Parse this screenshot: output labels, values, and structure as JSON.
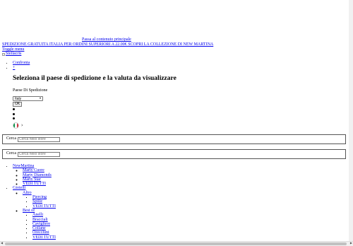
{
  "skip_link": "Passa al contenuto principale",
  "promo": "SPEDIZIONE GRATUITA ITALIA PER ORDINI SUPERIORI A 22.00€ SCOPRI LA COLLEZIONE DI NEW MARTINA",
  "toggle_menu": "Toggle menu",
  "logo_alt": "Stellacris",
  "top_links": {
    "compare": "Confronta",
    "empty": "+"
  },
  "shipping": {
    "title": "Seleziona il paese di spedizione e la valuta da visualizzare",
    "label": "Paese Di Spedizione",
    "selected_country": "Italy",
    "ok": "OK"
  },
  "flag": {
    "colors": [
      "#009246",
      "#ffffff",
      "#ce2b37"
    ],
    "chevron": "›"
  },
  "search": {
    "label": "Cerca",
    "placeholder": "Cerca nello store"
  },
  "menu": {
    "newmartina": "NewMartina",
    "nm_items": [
      "Marty Cuore",
      "Marty Diamonds",
      "Marty Star",
      "VEDI TUTTI"
    ],
    "gioielli": "Gioielli",
    "altro": "Altro",
    "altro_items": [
      "Piercing",
      "Spille",
      "VEDI TUTTI"
    ],
    "best_of": "Best of",
    "best_items": [
      "Anelli",
      "Bracciali",
      "Cavigliere",
      "Collane",
      "Orecchini",
      "VEDI TUTTI"
    ]
  }
}
